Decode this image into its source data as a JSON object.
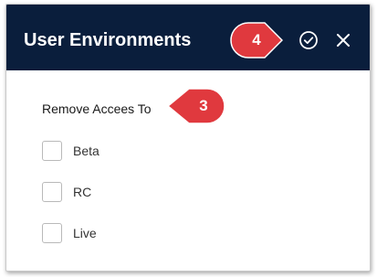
{
  "dialog": {
    "title": "User Environments",
    "section_label": "Remove Accees To",
    "options": [
      {
        "label": "Beta",
        "checked": false
      },
      {
        "label": "RC",
        "checked": false
      },
      {
        "label": "Live",
        "checked": false
      }
    ],
    "header_icons": [
      "check-circle-icon",
      "close-icon"
    ]
  },
  "callouts": [
    {
      "number": "4"
    },
    {
      "number": "3"
    }
  ],
  "colors": {
    "header_bg": "#0a1e3c",
    "callout_red": "#e0393e"
  }
}
